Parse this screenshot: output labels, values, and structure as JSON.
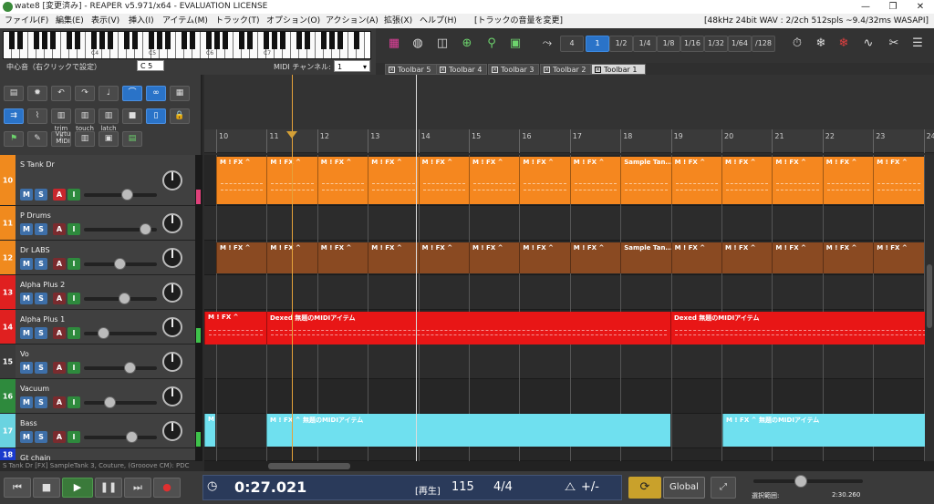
{
  "window": {
    "title": "wate8 [変更済み] - REAPER v5.971/x64 - EVALUATION LICENSE",
    "controls": [
      "—",
      "❐",
      "✕"
    ]
  },
  "menu": {
    "items": [
      "ファイル(F)",
      "編集(E)",
      "表示(V)",
      "挿入(I)",
      "アイテム(M)",
      "トラック(T)",
      "オプション(O)",
      "アクション(A)",
      "拡張(X)",
      "ヘルプ(H)",
      "[トラックの音量を変更]"
    ],
    "audio_info": "[48kHz 24bit WAV : 2/2ch 512spls ~9.4/32ms WASAPI]"
  },
  "keyboard": {
    "octave_labels": [
      "C4",
      "C5",
      "C6",
      "C7"
    ],
    "center_label": "中心音（右クリックで設定）",
    "center_value": "C 5",
    "channel_label": "MIDI チャンネル:",
    "channel_value": "1"
  },
  "grid_toolbar": {
    "buttons": [
      "4",
      "1",
      "1/2",
      "1/4",
      "1/8",
      "1/16",
      "1/32",
      "1/64",
      "/128"
    ],
    "active": "1"
  },
  "toolbar_tabs": [
    "Toolbar 5",
    "Toolbar 4",
    "Toolbar 3",
    "Toolbar 2",
    "Toolbar 1"
  ],
  "left_toolbar": {
    "labels": [
      "trim",
      "touch",
      "latch",
      "Virtu",
      "MIDI"
    ]
  },
  "tracks": [
    {
      "num": "10",
      "name": "S Tank Dr",
      "color": "#f08a1e",
      "armed": true
    },
    {
      "num": "11",
      "name": "P Drums",
      "color": "#f08a1e",
      "armed": false
    },
    {
      "num": "12",
      "name": "Dr LABS",
      "color": "#f08a1e",
      "armed": false
    },
    {
      "num": "13",
      "name": "Alpha Plus 2",
      "color": "#e02020",
      "armed": false
    },
    {
      "num": "14",
      "name": "Alpha Plus 1",
      "color": "#e02020",
      "armed": false
    },
    {
      "num": "15",
      "name": "Vo",
      "color": "#3a3a3a",
      "armed": false
    },
    {
      "num": "16",
      "name": "Vacuum",
      "color": "#2e8a3d",
      "armed": false
    },
    {
      "num": "17",
      "name": "Bass",
      "color": "#6ad3e0",
      "armed": false
    },
    {
      "num": "18",
      "name": "Gt chain",
      "color": "#1a3acc",
      "armed": false
    }
  ],
  "track_buttons": {
    "m": "M",
    "s": "S",
    "a": "A",
    "i": "I"
  },
  "ruler": {
    "bars": [
      "10",
      "11",
      "12",
      "13",
      "14",
      "15",
      "16",
      "17",
      "18",
      "19",
      "20",
      "21",
      "22",
      "23",
      "24"
    ]
  },
  "items": {
    "header": "M ! FX ^",
    "sample_tank": "Sample Tan...",
    "dexed": "Dexed 無題のMIDIアイテム",
    "bass_item": "M ! FX ^ 無題のMIDIアイテム"
  },
  "status": "S Tank Dr [FX] SampleTank 3, Couture, (Grooove CM): PDC",
  "transport": {
    "time": "0:27.021",
    "state": "[再生]",
    "bpm": "115",
    "signature": "4/4",
    "metronome_label": "+/-",
    "global": "Global",
    "selection_label": "選択範囲:",
    "selection_end": "2:30.260"
  },
  "colors": {
    "orange_item": "#f5871f",
    "brown_item": "#8a4a22",
    "red_item": "#e81616",
    "cyan_item": "#6fe0ef",
    "accent_blue": "#2a73c8"
  }
}
